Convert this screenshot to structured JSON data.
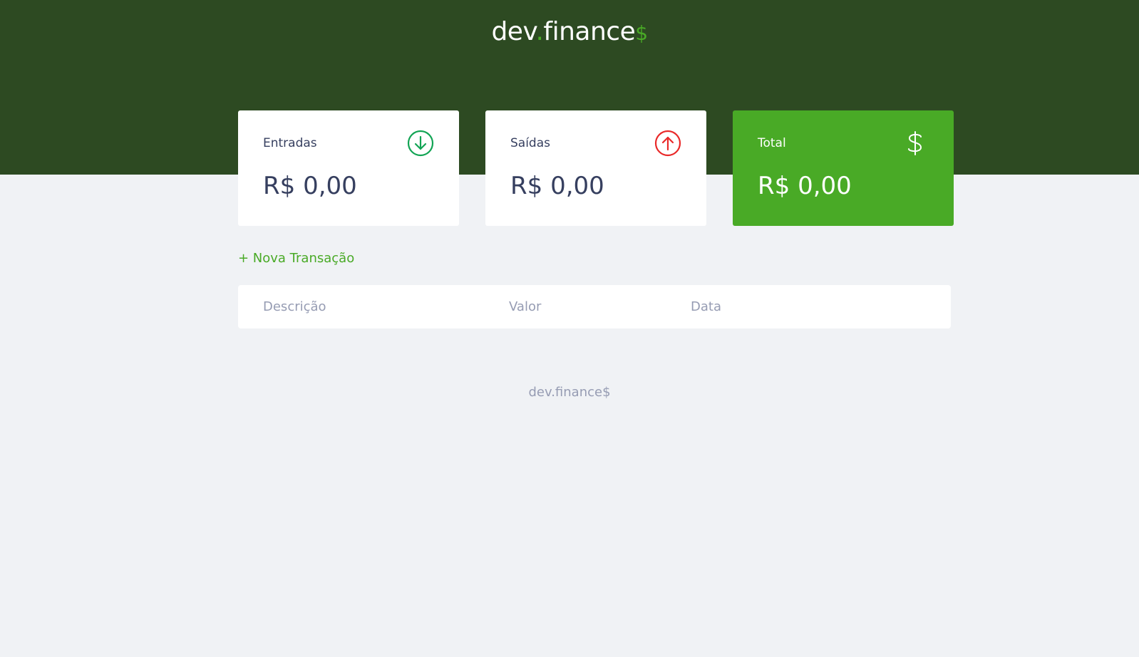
{
  "header": {
    "logo": {
      "prefix": "dev",
      "dot": ".",
      "name": "finance",
      "sign": "$"
    }
  },
  "cards": {
    "entradas": {
      "label": "Entradas",
      "value": "R$ 0,00",
      "icon": "arrow-down-circle-icon",
      "icon_color": "#12a454"
    },
    "saidas": {
      "label": "Saídas",
      "value": "R$ 0,00",
      "icon": "arrow-up-circle-icon",
      "icon_color": "#e92929"
    },
    "total": {
      "label": "Total",
      "value": "R$ 0,00",
      "icon": "dollar-sign-icon",
      "bg_color": "#49aa26"
    }
  },
  "actions": {
    "new_transaction": "+ Nova Transação"
  },
  "table": {
    "columns": [
      "Descrição",
      "Valor",
      "Data"
    ]
  },
  "footer": {
    "text": "dev.finance$"
  },
  "colors": {
    "header_bg": "#2d4a22",
    "accent": "#49aa26",
    "page_bg": "#f0f2f5",
    "text_dark": "#363f5f",
    "text_muted": "#969cb3"
  }
}
